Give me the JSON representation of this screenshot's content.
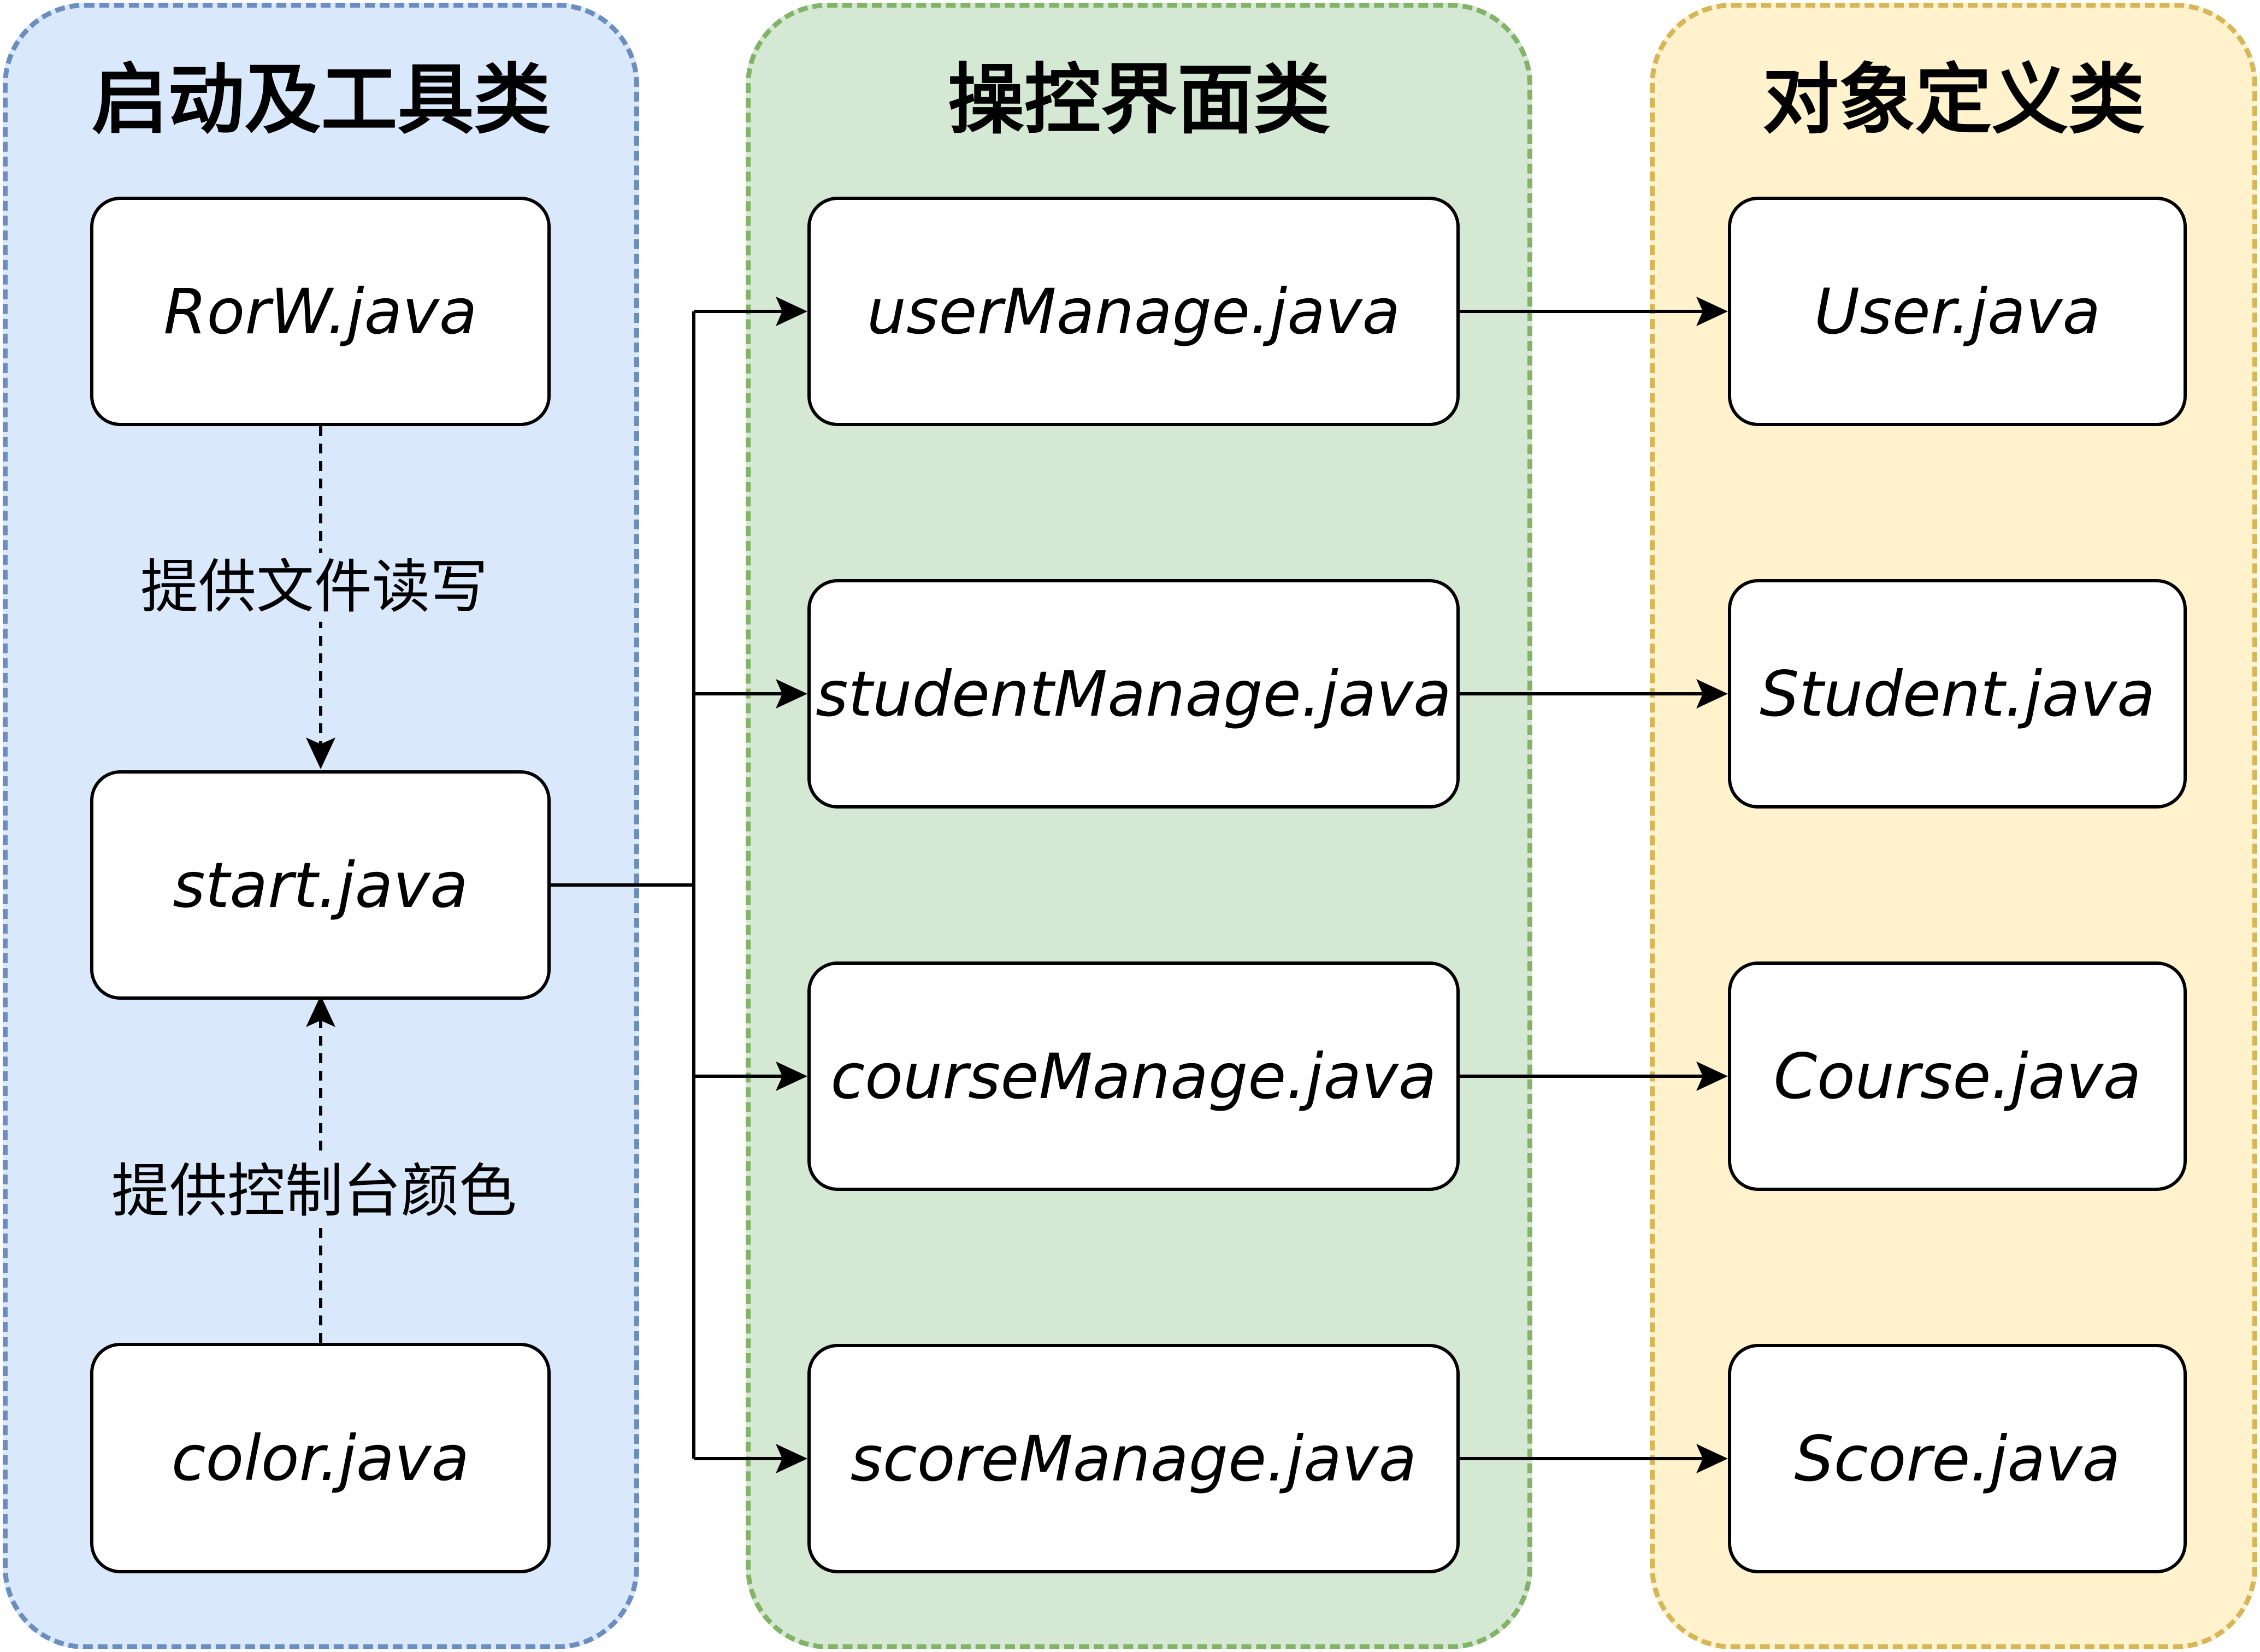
{
  "colors": {
    "tools_fill": "#dae8fc",
    "tools_border": "#6c8ebf",
    "ui_fill": "#d5e8d4",
    "ui_border": "#82b366",
    "model_fill": "#fff2cc",
    "model_border": "#d6b656",
    "line": "#000000"
  },
  "lanes": {
    "tools": {
      "title": "启动及工具类"
    },
    "ui": {
      "title": "操控界面类"
    },
    "model": {
      "title": "对象定义类"
    }
  },
  "nodes": {
    "rorw": "RorW.java",
    "start": "start.java",
    "color": "color.java",
    "user_manage": "userManage.java",
    "student_manage": "studentManage.java",
    "course_manage": "courseManage.java",
    "score_manage": "scoreManage.java",
    "user": "User.java",
    "student": "Student.java",
    "course": "Course.java",
    "score": "Score.java"
  },
  "edges": {
    "rorw_to_start": "提供文件读写",
    "color_to_start": "提供控制台颜色"
  }
}
